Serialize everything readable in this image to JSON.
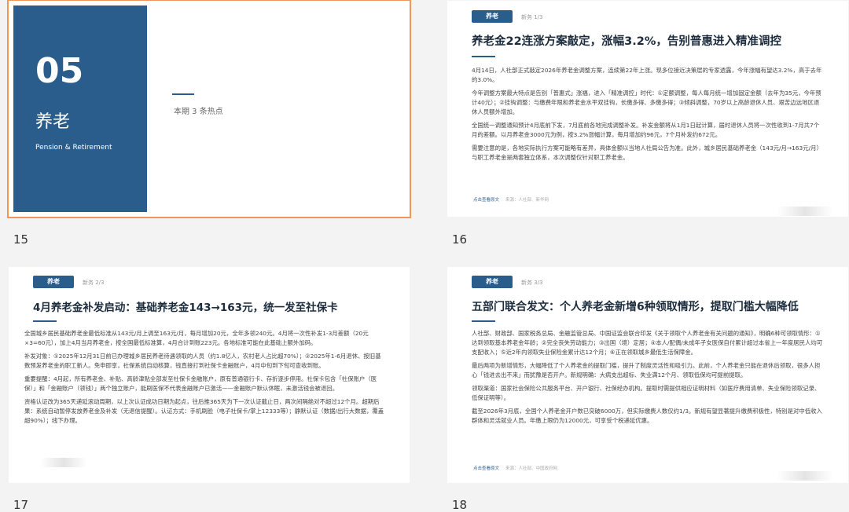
{
  "slides": [
    {
      "number": "15",
      "big_number": "05",
      "title": "养老",
      "subtitle": "Pension & Retirement",
      "caption": "本期 3 条热点"
    },
    {
      "number": "16",
      "tag": "养老",
      "page": "新务 1/3",
      "headline": "养老金22连涨方案敲定，涨幅3.2%，告别普惠进入精准调控",
      "paragraphs": [
        "4月14日，人社部正式敲定2026年养老金调整方案，连续第22年上涨。现多位接近决策层的专家透露，今年涨幅有望达3.2%，高于去年的3.0%。",
        "今年调整方案最大特点是告别「普惠式」涨福，进入「精准调控」时代：①定额调整，每人每月统一增加固定金额（去年为35元，今年预计40元）；②挂钩调整：与缴费年限和养老金水平双挂钩，长缴多得、多缴多得；③倾斜调整，70岁以上高龄退休人员、艰苦边远地区退休人员额外增加。",
        "全国统一调整通知预计4月底前下发，7月底前各地完成调整补发。补发金额将从1月1日起计算，届时退休人员将一次性收到1-7月共7个月的差额。以月养老金3000元为例，按3.2%涨幅计算，每月增加约96元，7个月补发约672元。",
        "需要注意的是，各地实际执行方案可能略有差异，具体金额以当地人社局公告为准。此外，城乡居民基础养老金（143元/月→163元/月）与职工养老金是两套独立体系，本次调整仅针对职工养老金。"
      ],
      "footer_link": "点击查看原文",
      "footer_source": "来源：人社部、新华网"
    },
    {
      "number": "17",
      "tag": "养老",
      "page": "新务 2/3",
      "headline": "4月养老金补发启动：基础养老金143→163元，统一发至社保卡",
      "paragraphs": [
        "全国城乡居民基础养老金最低标准从143元/月上调至163元/月，每月增加20元，全年多领240元。4月将一次性补发1-3月差额（20元×3=60元），加上4月当月养老金，按全国最低标准算，4月合计到账223元。各地标准可能在此基础上额外加码。",
        "补发对象：①2025年12月31日前已办理城乡居民养老待遇领取的人员（约1.8亿人，农村老人占比超70%）；②2025年1-6月退休、按旧基数预发养老金的职工新人。免申即享，社保系统自动核算，钱直接打到社保卡金融账户，4月中旬到下旬可查收到账。",
        "重要提醒：4月起，所有养老金、补贴、高龄津贴全部发至社保卡金融账户，原有普通银行卡、存折逐步停用。社保卡包含「社保账户（医保）」和「金融账户（领钱）」两个独立账户，能刷医保不代表金融账户已激活——金融账户默认休眠，未激活钱会被退回。",
        "资格认证改为365天递延滚动周期，以上次认证成功日期为起点，往后推365天为下一次认证截止日，两次间隔绝对不超过12个月。超期后果：系统自动暂停发放养老金及补发（无退信提醒）。认证方式：手机刷脸（电子社保卡/掌上12333等）；静默认证（数据/出行大数据，覆盖超90%）；线下办理。"
      ]
    },
    {
      "number": "18",
      "tag": "养老",
      "page": "新务 3/3",
      "headline": "五部门联合发文：个人养老金新增6种领取情形，提取门槛大幅降低",
      "paragraphs": [
        "人社部、财政部、国家税务总局、金融监管总局、中国证监会联合印发《关于领取个人养老金有关问题的通知》，明确6种可领取情形：①达到领取基本养老金年龄；②完全丧失劳动能力；③出国（境）定居；④本人/配偶/未成年子女医保自付累计超过本省上一年度居民人均可支配收入；⑤近2年内领取失业保险金累计达12个月；⑥正在领取城乡最低生活保障金。",
        "最后两项为新增情形，大幅降低了个人养老金的提取门槛，提升了制度灵活性和吸引力。此前，个人养老金只能在退休后领取，很多人担心「钱进去出不来」而犹豫是否开户。新规明确：大病支出超标、失业满12个月、领取低保均可提前提取。",
        "领取渠道：国家社会保险公共服务平台、开户银行、社保经办机构。提取时需提供相应证明材料（如医疗费用清单、失业保险领取记录、低保证明等）。",
        "截至2026年3月底，全国个人养老金开户数已突破6000万，但实际缴费人数仅约1/3。新规有望显著提升缴费积极性，特别是对中低收入群体和灵活就业人员。年缴上限仍为12000元，可享受个税递延优惠。"
      ],
      "footer_link": "点击查看原文",
      "footer_source": "来源：人社部、中国政府网"
    }
  ]
}
